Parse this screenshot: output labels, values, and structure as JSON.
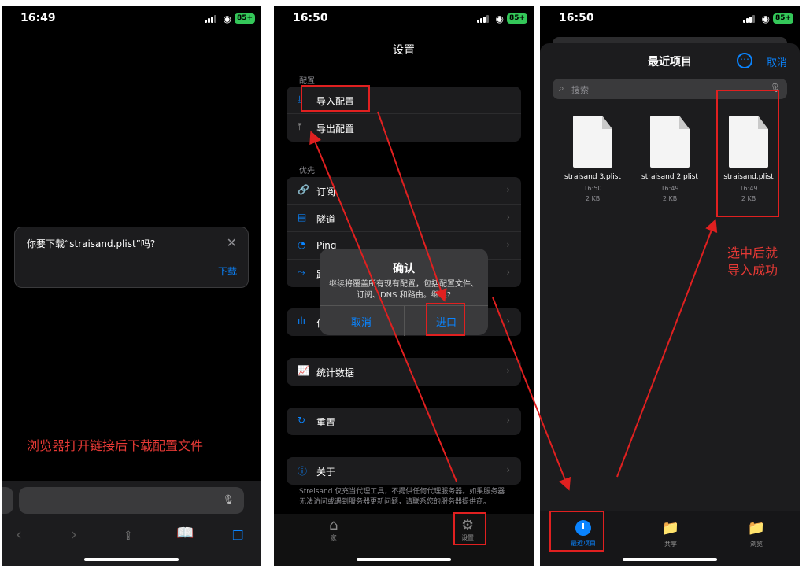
{
  "panel1": {
    "time": "16:49",
    "battery": "85+",
    "download_prompt": "你要下载“straisand.plist”吗?",
    "download_button": "下载",
    "note": "浏览器打开链接后下载配置文件"
  },
  "panel2": {
    "time": "16:50",
    "battery": "85+",
    "title": "设置",
    "sections": {
      "config": "配置",
      "priority": "优先"
    },
    "rows": {
      "import": "导入配置",
      "export": "导出配置",
      "subscribe": "订阅",
      "tunnel": "隧道",
      "ping": "Ping",
      "route": "路",
      "perf": "付",
      "stats": "统计数据",
      "reset": "重置",
      "about": "关于"
    },
    "disclaimer": "Streisand 仅充当代理工具，不提供任何代理服务器。如果服务器无法访问或遇到服务器更新问题，请联系您的服务器提供商。",
    "tabs": {
      "home": "家",
      "settings": "设置"
    },
    "alert": {
      "title": "确认",
      "message": "继续将覆盖所有现有配置，包括配置文件、订阅、DNS 和路由。继续?",
      "cancel": "取消",
      "confirm": "进口"
    }
  },
  "panel3": {
    "time": "16:50",
    "battery": "85+",
    "title": "最近项目",
    "cancel": "取消",
    "search_placeholder": "搜索",
    "files": [
      {
        "name": "straisand 3.plist",
        "time": "16:50",
        "size": "2 KB"
      },
      {
        "name": "straisand 2.plist",
        "time": "16:49",
        "size": "2 KB"
      },
      {
        "name": "straisand.plist",
        "time": "16:49",
        "size": "2 KB"
      }
    ],
    "tabs": {
      "recent": "最近项目",
      "shared": "共享",
      "browse": "浏览"
    },
    "note_line1": "选中后就",
    "note_line2": "导入成功"
  },
  "colors": {
    "accent": "#0a84ff",
    "annotation": "#e02020",
    "battery": "#34c759"
  }
}
